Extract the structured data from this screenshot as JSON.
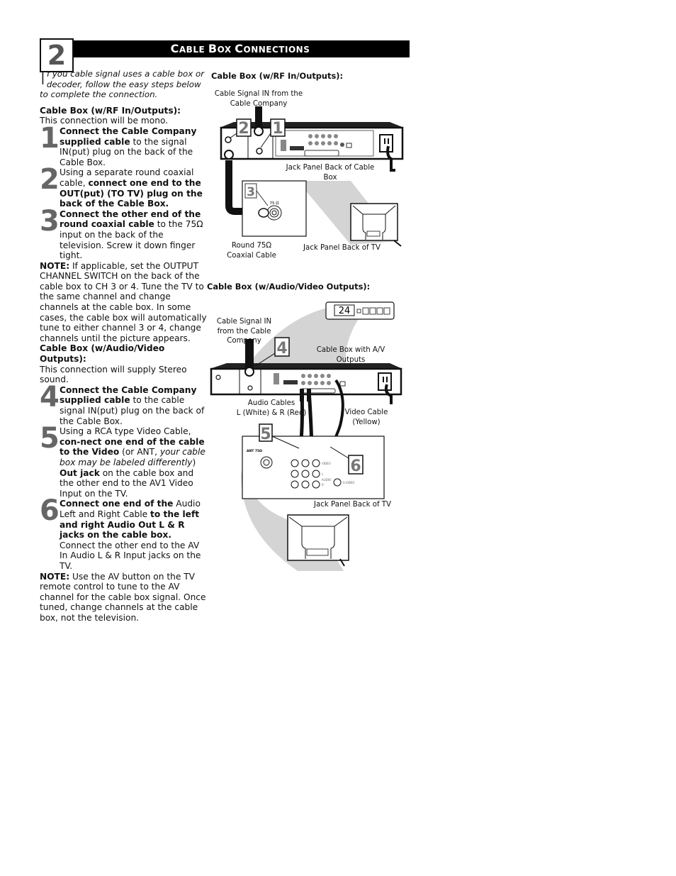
{
  "header": {
    "section_number": "2",
    "title_parts": [
      {
        "big": "C",
        "small": "ABLE "
      },
      {
        "big": "B",
        "small": "OX "
      },
      {
        "big": "C",
        "small": "ONNECTIONS"
      }
    ],
    "title": "Cable Box Connections"
  },
  "intro": {
    "dropcap": "I",
    "text": "f you cable signal uses a cable box or decoder, follow the easy steps below to complete the connection."
  },
  "rf_section": {
    "heading": "Cable Box (w/RF In/Outputs):",
    "subtext": "This connection will be mono.",
    "steps": [
      {
        "number": "1",
        "bold": "Connect the Cable Company supplied cable",
        "rest": " to the signal IN(put) plug on the back of the Cable Box."
      },
      {
        "number": "2",
        "lead": "Using a separate round coaxial cable, ",
        "bold": "connect one end to the OUT(put) (TO TV) plug on the back of the Cable Box."
      },
      {
        "number": "3",
        "bold": "Connect the other end of the round coaxial cable",
        "rest": " to the 75Ω input on the back of the television. Screw it down finger tight."
      }
    ],
    "note_label": "NOTE:",
    "note_text": " If applicable, set the OUTPUT CHANNEL SWITCH on the back of the cable box to CH 3 or 4. Tune the TV to the same channel and change channels at the cable box. In some cases, the cable box will automatically tune to either channel 3 or 4, change channels until the picture appears."
  },
  "av_section": {
    "heading": "Cable Box (w/Audio/Video Outputs):",
    "subtext": "This connection will supply Stereo sound.",
    "step4": {
      "number": "4",
      "bold": "Connect the Cable Company supplied cable",
      "rest": " to the cable signal IN(put) plug on the back of the Cable Box."
    },
    "step5": {
      "number": "5",
      "lead": "Using a RCA type Video Cable, ",
      "bold1": "con-nect one end of the cable to the Video",
      "mid": " (or ANT, ",
      "italic": "your cable box may be labeled differently",
      "close": ") ",
      "bold2": "Out jack",
      "rest": " on the cable box and the other end to the AV1 Video Input on the TV."
    },
    "step6": {
      "number": "6",
      "bold1": "Connect one end of the",
      "mid": " Audio Left and Right Cable ",
      "bold2": "to the left and right Audio Out L & R jacks on the cable box.",
      "rest": " Connect the other end to the AV In Audio L & R Input jacks on the TV."
    },
    "note_label": "NOTE:",
    "note_text": " Use the AV button on the TV remote control to tune to the AV channel for the cable box signal. Once tuned, change channels at the cable box, not the television."
  },
  "diagram_rf": {
    "heading": "Cable Box (w/RF In/Outputs):",
    "label_signal_in": [
      "Cable Signal IN from the",
      "Cable Company"
    ],
    "label_jack_panel_box": "Jack Panel Back of Cable Box",
    "label_coax": [
      "Round 75Ω",
      "Coaxial Cable"
    ],
    "label_jack_panel_tv": "Jack Panel Back of TV",
    "callouts": [
      "2",
      "1",
      "3"
    ],
    "ohm_label": "75 Ω"
  },
  "diagram_av": {
    "heading": "Cable Box (w/Audio/Video Outputs):",
    "display_value": "24",
    "label_signal_in": [
      "Cable Signal IN",
      "from the Cable",
      "Company"
    ],
    "label_box": "Cable Box with A/V Outputs",
    "label_audio": [
      "Audio Cables",
      "L (White) & R (Red)"
    ],
    "label_video": [
      "Video Cable",
      "(Yellow)"
    ],
    "label_jack_panel_tv": "Jack Panel Back of TV",
    "callouts": [
      "4",
      "5",
      "6"
    ],
    "tv_jack_labels": {
      "ant": "ANT 75Ω",
      "video": "VIDEO",
      "l": "L",
      "audio": "AUDIO",
      "r": "R",
      "svideo": "S-VIDEO"
    }
  }
}
